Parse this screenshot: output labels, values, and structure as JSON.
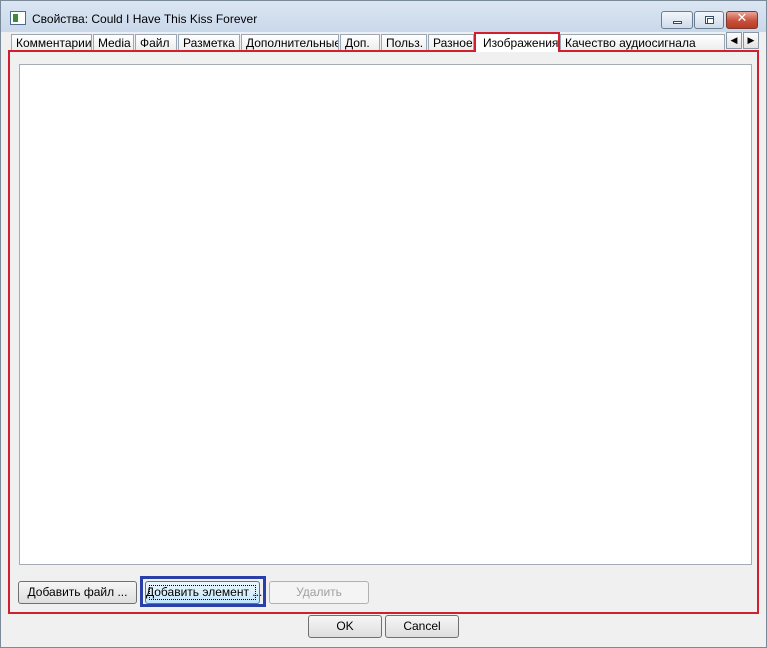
{
  "window": {
    "title": "Свойства: Could I Have This Kiss Forever",
    "icon": "app-icon",
    "controls": {
      "minimize_icon": "minimize-icon",
      "maximize_icon": "maximize-icon",
      "close_glyph": "✕"
    }
  },
  "tabs": [
    {
      "label": "Комментарии"
    },
    {
      "label": "Media"
    },
    {
      "label": "Файл"
    },
    {
      "label": "Разметка"
    },
    {
      "label": "Дополнительные"
    },
    {
      "label": "Доп."
    },
    {
      "label": "Польз."
    },
    {
      "label": "Разное"
    },
    {
      "label": "Изображения",
      "active": true
    },
    {
      "label": "Качество аудиосигнала"
    }
  ],
  "tab_scroll": {
    "left": "◀",
    "right": "▶"
  },
  "images_page": {
    "buttons": {
      "add_file": "Добавить файл ...",
      "add_element": "Добавить элемент ...",
      "delete": "Удалить"
    }
  },
  "footer": {
    "ok": "OK",
    "cancel": "Cancel"
  },
  "colors": {
    "highlight_red": "#d0202e",
    "highlight_blue": "#2a3fa8"
  }
}
